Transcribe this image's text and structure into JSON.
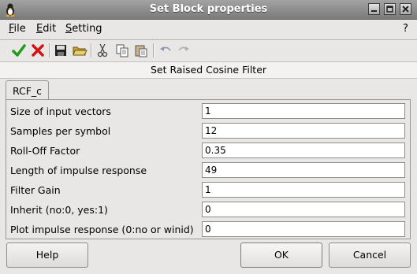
{
  "window": {
    "title": "Set Block properties"
  },
  "menu": {
    "file": "File",
    "edit": "Edit",
    "setting": "Setting",
    "help": "?"
  },
  "header": {
    "title": "Set Raised Cosine Filter"
  },
  "tabs": [
    {
      "label": "RCF_c"
    }
  ],
  "fields": [
    {
      "label": "Size of input vectors",
      "value": "1"
    },
    {
      "label": "Samples per symbol",
      "value": "12"
    },
    {
      "label": "Roll-Off Factor",
      "value": "0.35"
    },
    {
      "label": "Length of impulse response",
      "value": "49"
    },
    {
      "label": "Filter Gain",
      "value": "1"
    },
    {
      "label": "Inherit (no:0, yes:1)",
      "value": "0"
    },
    {
      "label": "Plot impulse response (0:no or winid)",
      "value": "0"
    }
  ],
  "buttons": {
    "help": "Help",
    "ok": "OK",
    "cancel": "Cancel"
  },
  "icons": {
    "toolbar": [
      "check-icon",
      "cross-icon",
      "save-icon",
      "open-folder-icon",
      "cut-icon",
      "copy-icon",
      "paste-icon",
      "undo-icon",
      "redo-icon"
    ],
    "window": [
      "minimize-icon",
      "maximize-icon",
      "close-icon"
    ]
  },
  "colors": {
    "check": "#1f9a1f",
    "cross": "#d21414",
    "titlebar": "#8c8c8c"
  }
}
